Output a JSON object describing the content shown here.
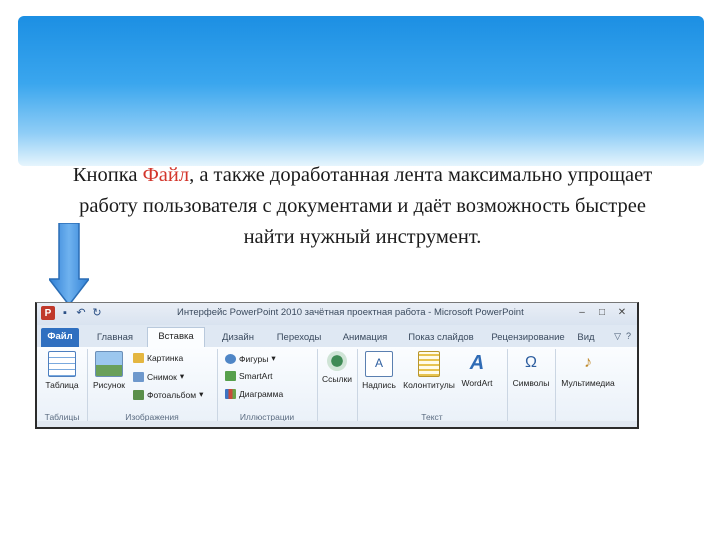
{
  "slide": {
    "text_part1": "Кнопка ",
    "text_accent": "Файл",
    "text_part2": ", а также доработанная лента максимально упрощает работу пользователя с документами  и даёт возможность быстрее найти нужный инструмент."
  },
  "window": {
    "app_icon": "P",
    "title": "Интерфейс PowerPoint 2010 зачётная проектная работа - Microsoft PowerPoint",
    "buttons": [
      "–",
      "□",
      "✕"
    ]
  },
  "tabs": [
    {
      "label": "Файл"
    },
    {
      "label": "Главная"
    },
    {
      "label": "Вставка"
    },
    {
      "label": "Дизайн"
    },
    {
      "label": "Переходы"
    },
    {
      "label": "Анимация"
    },
    {
      "label": "Показ слайдов"
    },
    {
      "label": "Рецензирование"
    },
    {
      "label": "Вид"
    }
  ],
  "ribbon": {
    "groups": [
      {
        "label": "Таблицы"
      },
      {
        "label": "Изображения"
      },
      {
        "label": "Иллюстрации"
      },
      {
        "label": "Текст"
      }
    ],
    "buttons": {
      "table": "Таблица",
      "picture": "Рисунок",
      "clipart": "Картинка",
      "screenshot": "Снимок",
      "photoalbum": "Фотоальбом",
      "shapes": "Фигуры",
      "smartart": "SmartArt",
      "chart": "Диаграмма",
      "links": "Ссылки",
      "textbox": "Надпись",
      "headerfooter": "Колонтитулы",
      "wordart": "WordArt",
      "symbols": "Символы",
      "media": "Мультимедиа"
    }
  },
  "colors": {
    "accent": "#d3352b",
    "header_blue": "#1c8fe3",
    "arrow_blue": "#3b8ee0"
  },
  "icons": [
    "blue-arrow-down-icon",
    "powerpoint-app-icon",
    "save-icon",
    "undo-icon",
    "redo-icon",
    "table-icon",
    "picture-icon",
    "clipart-icon",
    "screenshot-icon",
    "photoalbum-icon",
    "shapes-icon",
    "smartart-icon",
    "chart-icon",
    "links-icon",
    "textbox-icon",
    "headerfooter-icon",
    "wordart-icon",
    "symbols-icon",
    "media-icon"
  ]
}
